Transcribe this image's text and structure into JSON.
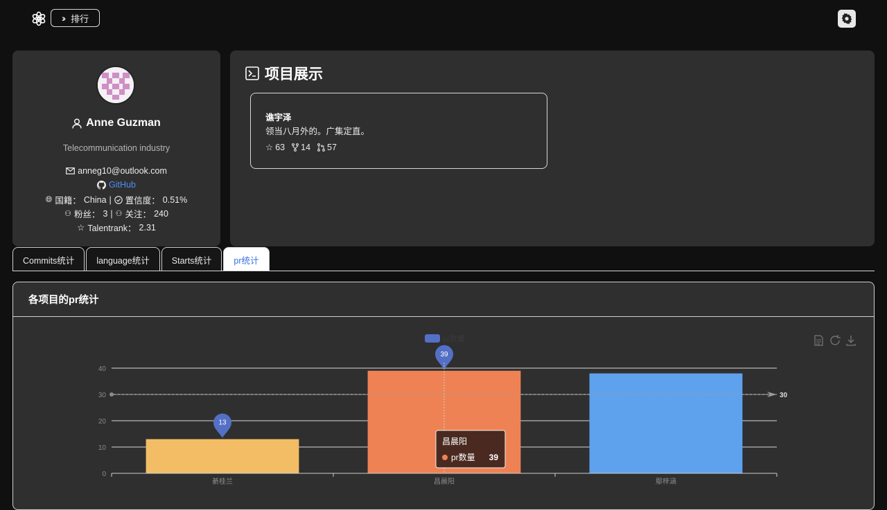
{
  "header": {
    "rank_label": "排行"
  },
  "profile": {
    "name": "Anne Guzman",
    "industry": "Telecommunication industry",
    "email": "anneg10@outlook.com",
    "github": "GitHub",
    "nationality_label": "国籍：",
    "nationality": "China",
    "sep": "|",
    "confidence_label": "置信度：",
    "confidence": "0.51%",
    "followers_label": "粉丝：",
    "followers": "3",
    "following_label": "关注：",
    "following": "240",
    "talentrank_label": "Talentrank：",
    "talentrank": "2.31"
  },
  "projects": {
    "title": "项目展示",
    "items": [
      {
        "name": "谯宇泽",
        "desc": "领当八月外的。广集定直。",
        "stars": "63",
        "forks": "14",
        "prs": "57"
      }
    ]
  },
  "tabs": [
    {
      "label": "Commits统计",
      "active": false
    },
    {
      "label": "language统计",
      "active": false
    },
    {
      "label": "Starts统计",
      "active": false
    },
    {
      "label": "pr统计",
      "active": true
    }
  ],
  "chart_section": {
    "title": "各项目的pr统计"
  },
  "chart_data": {
    "type": "bar",
    "categories": [
      "綦桂兰",
      "昌晨阳",
      "鄢梓涵"
    ],
    "series": [
      {
        "name": "pr数量",
        "values": [
          13,
          39,
          38
        ]
      }
    ],
    "colors": [
      "#f2bd65",
      "#ef8254",
      "#5ea2ee"
    ],
    "ylim": [
      0,
      40
    ],
    "yticks": [
      0,
      10,
      20,
      30,
      40
    ],
    "mark_points": [
      {
        "category": "綦桂兰",
        "value": 13
      },
      {
        "category": "昌晨阳",
        "value": 39
      }
    ],
    "mark_line": {
      "value": 30,
      "label": "30"
    },
    "tooltip": {
      "title": "昌晨阳",
      "series": "pr数量",
      "value": "39"
    }
  }
}
